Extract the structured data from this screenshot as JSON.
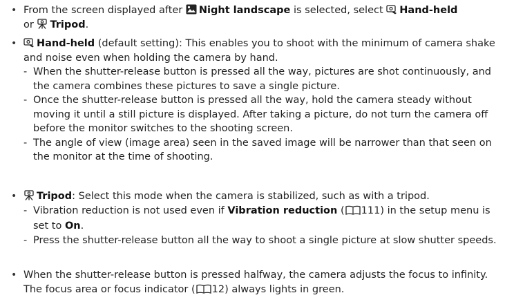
{
  "items": {
    "b1": {
      "prefix": "From the screen displayed after ",
      "night_label": "Night landscape",
      "mid": " is selected, select ",
      "handheld_label": "Hand-held",
      "or": "or ",
      "tripod_label": "Tripod",
      "end": "."
    },
    "b2": {
      "handheld_label": "Hand-held",
      "text": " (default setting): This enables you to shoot with the minimum of camera shake and noise even when holding the camera by hand.",
      "sub1": "When the shutter-release button is pressed all the way, pictures are shot continuously, and the camera combines these pictures to save a single picture.",
      "sub2": "Once the shutter-release button is pressed all the way, hold the camera steady without moving it until a still picture is displayed. After taking a picture, do not turn the camera off before the monitor switches to the shooting screen.",
      "sub3": "The angle of view (image area) seen in the saved image will be narrower than that seen on the monitor at the time of shooting."
    },
    "b3": {
      "tripod_label": "Tripod",
      "text": ": Select this mode when the camera is stabilized, such as with a tripod.",
      "sub1_prefix": "Vibration reduction is not used even if ",
      "sub1_bold": "Vibration reduction",
      "sub1_paren_open": " (",
      "sub1_page": "111",
      "sub1_mid": ") in the setup menu is set to ",
      "sub1_on": "On",
      "sub1_end": ".",
      "sub2": "Press the shutter-release button all the way to shoot a single picture at slow shutter speeds."
    },
    "b4": {
      "prefix": "When the shutter-release button is pressed halfway, the camera adjusts the focus to infinity. The focus area or focus indicator (",
      "page": "12",
      "suffix": ") always lights in green."
    }
  },
  "icons": {
    "night": "night-landscape-icon",
    "handheld": "hand-held-icon",
    "tripod": "tripod-icon",
    "book": "book-reference-icon"
  }
}
